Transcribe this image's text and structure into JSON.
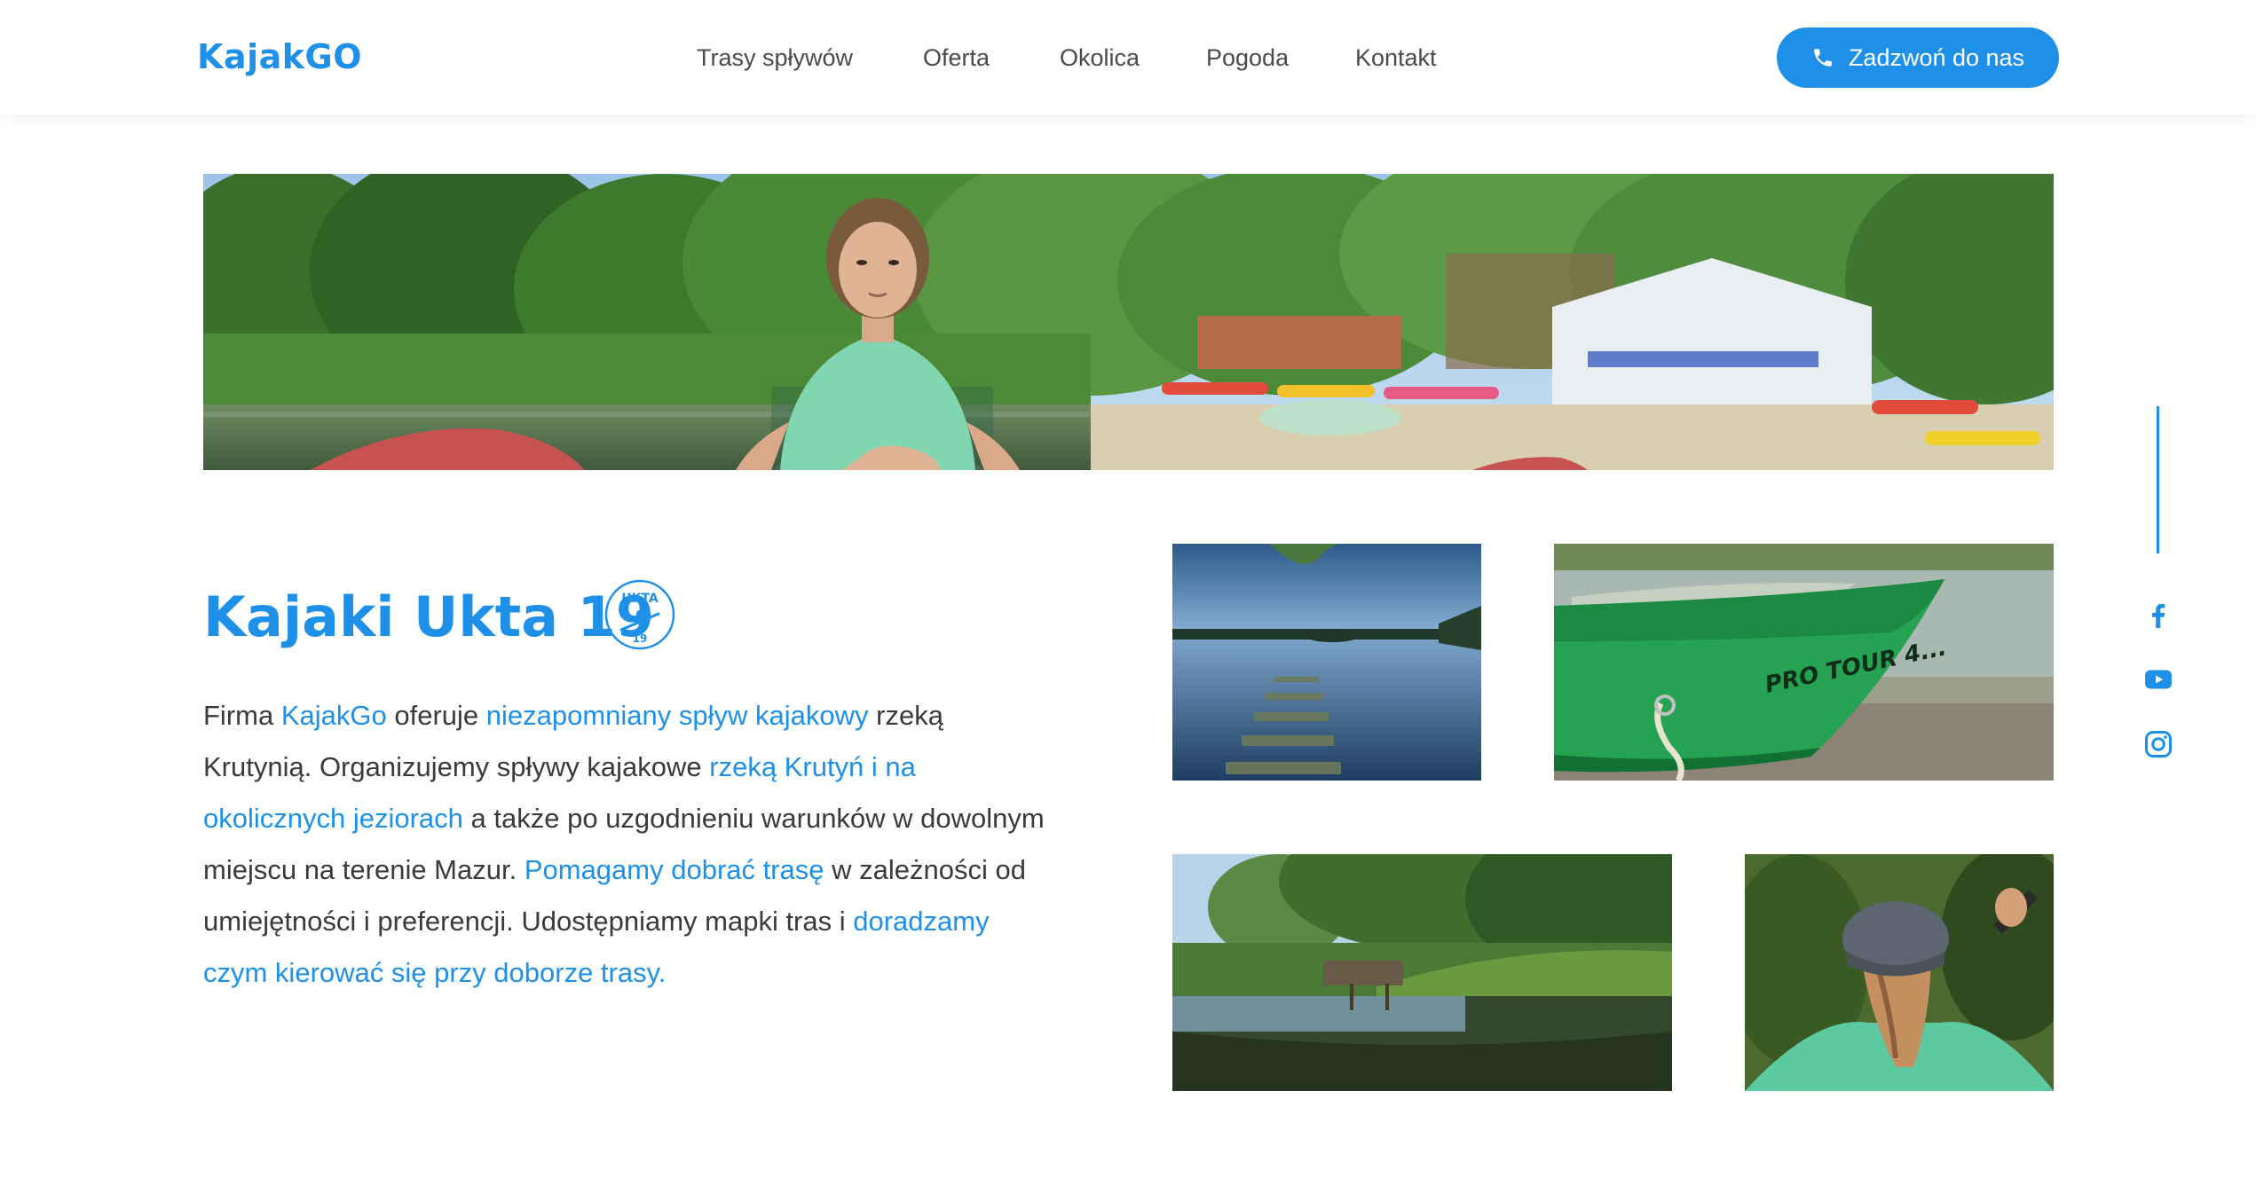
{
  "header": {
    "logo": "KajakGO",
    "nav": [
      {
        "label": "Trasy spływów"
      },
      {
        "label": "Oferta"
      },
      {
        "label": "Okolica"
      },
      {
        "label": "Pogoda"
      },
      {
        "label": "Kontakt"
      }
    ],
    "call_button": {
      "label": "Zadzwoń do nas",
      "icon": "phone-icon"
    }
  },
  "hero": {
    "image": "woman-in-kayak-on-river"
  },
  "content": {
    "title": "Kajaki Ukta 19",
    "badge": {
      "top_text": "UKTA",
      "bottom_text": "19",
      "icon": "kayaker-logo"
    },
    "paragraph": [
      {
        "text": "Firma ",
        "link": false
      },
      {
        "text": "KajakGo",
        "link": true
      },
      {
        "text": " oferuje ",
        "link": false
      },
      {
        "text": "niezapomniany spływ kajakowy",
        "link": true
      },
      {
        "text": " rzeką Krutynią. Organizujemy spływy kajakowe ",
        "link": false
      },
      {
        "text": "rzeką Krutyń i na okolicznych jeziorach",
        "link": true
      },
      {
        "text": " a także po uzgodnieniu warunków w dowolnym miejscu na terenie Mazur. ",
        "link": false
      },
      {
        "text": "Pomagamy dobrać trasę",
        "link": true
      },
      {
        "text": " w zależności od umiejętności i preferencji. Udostępniamy mapki tras i ",
        "link": false
      },
      {
        "text": "doradzamy czym kierować się przy doborze trasy.",
        "link": true
      }
    ]
  },
  "gallery": [
    {
      "image": "lake-pier-photo"
    },
    {
      "image": "green-kayak-photo",
      "kayak_text": "PRO TOUR 4..."
    },
    {
      "image": "river-reeds-photo"
    },
    {
      "image": "woman-paddling-photo"
    }
  ],
  "social": [
    {
      "icon": "facebook-icon"
    },
    {
      "icon": "youtube-icon"
    },
    {
      "icon": "instagram-icon"
    }
  ],
  "colors": {
    "accent": "#1e90e8",
    "text": "#3a3a3a",
    "nav_text": "#4a4a4a",
    "background": "#ffffff"
  }
}
